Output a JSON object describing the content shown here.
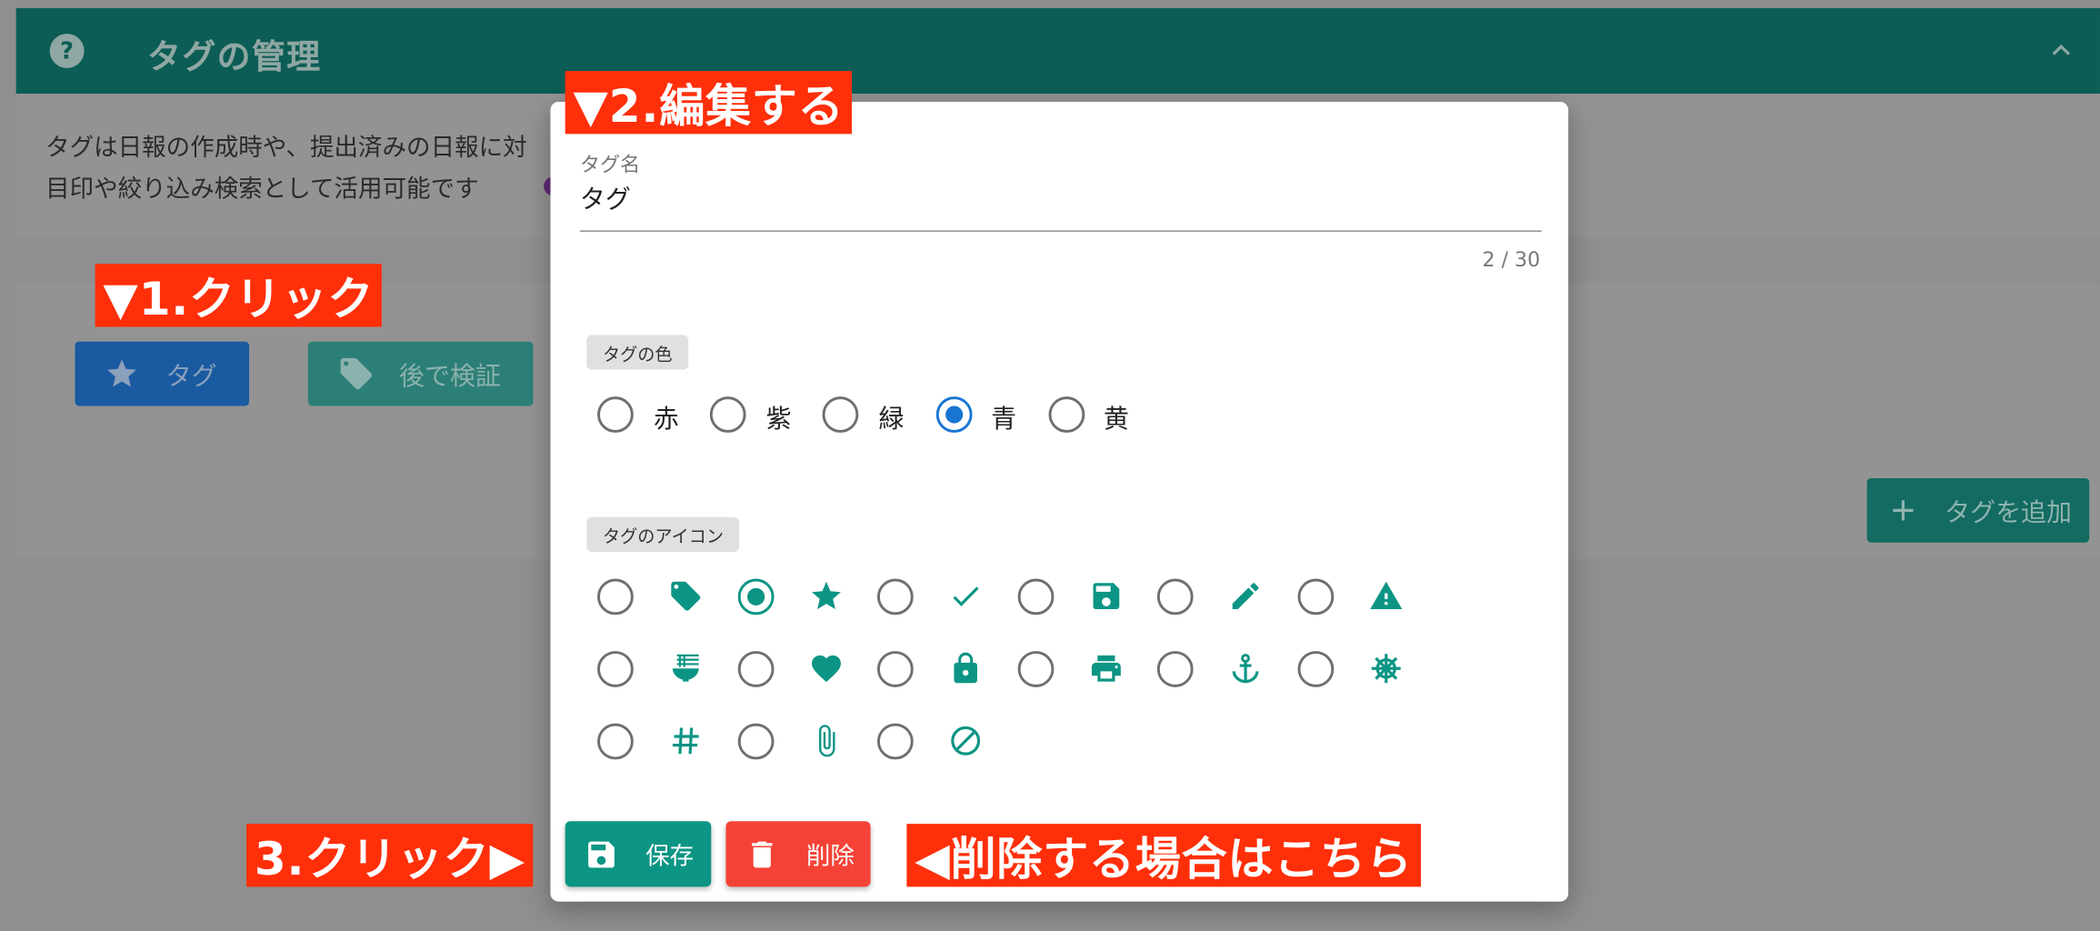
{
  "page": {
    "title": "タグの管理",
    "description_line1": "タグは日報の作成時や、提出済みの日報に対",
    "description_line2": "目印や絞り込み検索として活用可能です"
  },
  "tags": [
    {
      "label": "タグ",
      "icon": "star-icon",
      "color": "#195aa1"
    },
    {
      "label": "後で検証",
      "icon": "tag-icon",
      "color": "#2c7f77"
    }
  ],
  "add_tag_label": "タグを追加",
  "dialog": {
    "name_label": "タグ名",
    "name_value": "タグ",
    "counter": "2 / 30",
    "color_section": "タグの色",
    "colors": [
      {
        "label": "赤",
        "selected": false
      },
      {
        "label": "紫",
        "selected": false
      },
      {
        "label": "緑",
        "selected": false
      },
      {
        "label": "青",
        "selected": true
      },
      {
        "label": "黄",
        "selected": false
      }
    ],
    "icon_section": "タグのアイコン",
    "icons": [
      "tag-icon",
      "star-icon",
      "check-icon",
      "save-icon",
      "pencil-icon",
      "warning-icon",
      "noodle-bowl-icon",
      "heart-icon",
      "lock-icon",
      "printer-icon",
      "anchor-icon",
      "ship-wheel-icon",
      "hash-icon",
      "paperclip-icon",
      "block-icon"
    ],
    "selected_icon": "star-icon",
    "save_label": "保存",
    "delete_label": "削除"
  },
  "annotations": {
    "step1": "▼1.クリック",
    "step2": "▼2.編集する",
    "step3": "3.クリック▶",
    "delete_hint": "◀削除する場合はこちら"
  },
  "colors": {
    "header": "#0c5d55",
    "accent_teal": "#0c9584",
    "selected_blue": "#1976d2",
    "delete_red": "#f44336",
    "annotation_red": "#ff2f0a"
  }
}
